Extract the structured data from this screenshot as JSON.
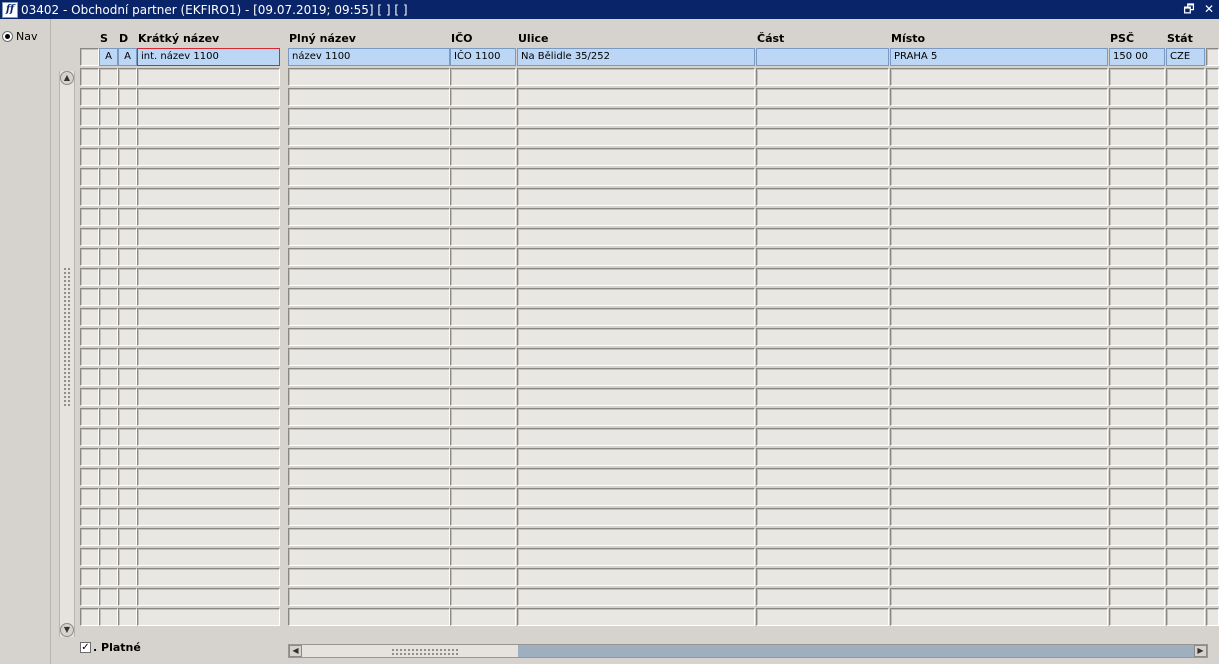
{
  "window": {
    "app_icon": "ff",
    "title": "03402 - Obchodní partner (EKFIRO1) - [09.07.2019; 09:55]  [ ]  [ ]",
    "restore_glyph": "🗗",
    "close_glyph": "✕"
  },
  "nav": {
    "label": "Nav"
  },
  "columns": {
    "s": "S",
    "d": "D",
    "kratky": "Krátký název",
    "plny": "Plný název",
    "ico": "IČO",
    "ulice": "Ulice",
    "cast": "Část",
    "misto": "Místo",
    "psc": "PSČ",
    "stat": "Stát"
  },
  "rows": [
    {
      "s": "A",
      "d": "A",
      "kratky": "int. název 1100",
      "plny": "název 1100",
      "ico": "IČO 1100",
      "ulice": "Na Bělidle 35/252",
      "cast": "",
      "misto": "PRAHA 5",
      "psc": "150 00",
      "stat": "CZE"
    }
  ],
  "empty_row_count": 28,
  "footer": {
    "checkbox_checked": true,
    "checkbox_mark": "✓",
    "checkbox_label": ". Platné"
  },
  "colors": {
    "title_bar": "#0a246a",
    "selected_row": "#bcd7f5",
    "active_cell_border": "#d8282f"
  }
}
